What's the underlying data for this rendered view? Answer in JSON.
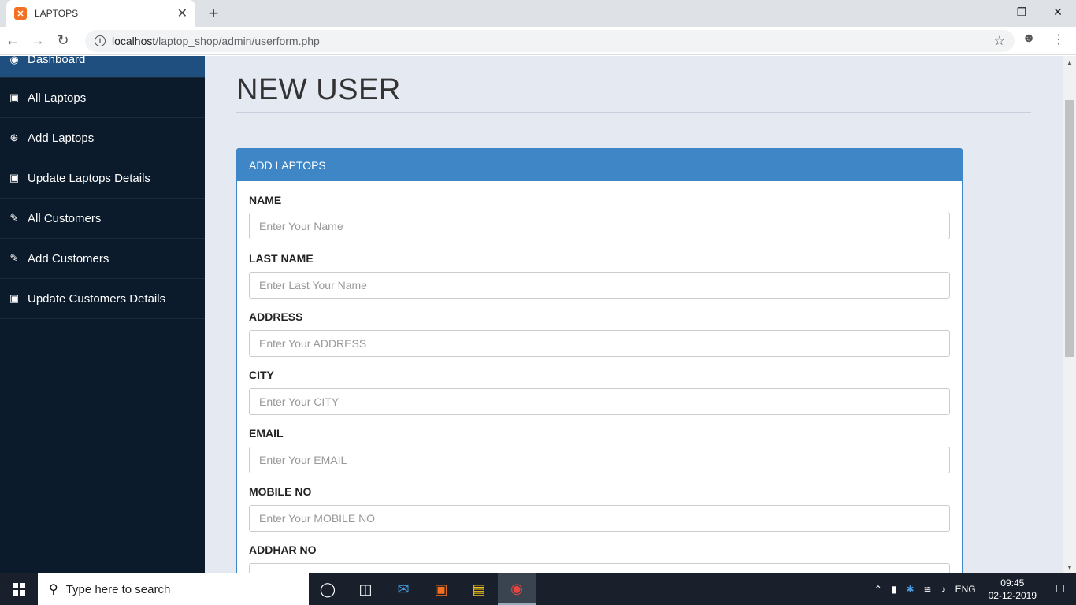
{
  "browser": {
    "tab_title": "LAPTOPS",
    "tab_close": "✕",
    "new_tab": "+",
    "url_host": "localhost",
    "url_path": "/laptop_shop/admin/userform.php"
  },
  "sidebar": {
    "items": [
      {
        "label": "Dashboard",
        "icon": "dashboard-icon"
      },
      {
        "label": "All Laptops",
        "icon": "desktop-icon"
      },
      {
        "label": "Add Laptops",
        "icon": "plus-circle-icon"
      },
      {
        "label": "Update Laptops Details",
        "icon": "desktop-icon"
      },
      {
        "label": "All Customers",
        "icon": "edit-icon"
      },
      {
        "label": "Add Customers",
        "icon": "edit-icon"
      },
      {
        "label": "Update Customers Details",
        "icon": "desktop-icon"
      }
    ]
  },
  "page": {
    "title": "NEW USER",
    "panel_title": "ADD LAPTOPS",
    "fields": [
      {
        "label": "NAME",
        "placeholder": "Enter Your Name"
      },
      {
        "label": "LAST NAME",
        "placeholder": "Enter Last Your Name"
      },
      {
        "label": "ADDRESS",
        "placeholder": "Enter Your ADDRESS"
      },
      {
        "label": "CITY",
        "placeholder": "Enter Your CITY"
      },
      {
        "label": "EMAIL",
        "placeholder": "Enter Your EMAIL"
      },
      {
        "label": "MOBILE NO",
        "placeholder": "Enter Your MOBILE NO"
      },
      {
        "label": "ADDHAR NO",
        "placeholder": "Enter Your ADDHAR NO"
      }
    ]
  },
  "taskbar": {
    "search_text": "Type here to search",
    "language": "ENG",
    "time": "09:45",
    "date": "02-12-2019"
  }
}
